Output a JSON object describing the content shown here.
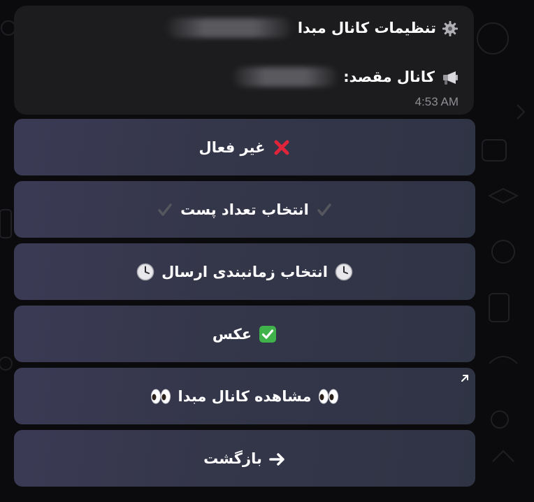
{
  "message": {
    "line1_text": "تنظیمات کانال مبدا",
    "line1_icon": "gear-icon",
    "line2_text": "کانال مقصد:",
    "line2_icon": "megaphone-icon",
    "time": "4:53 AM"
  },
  "keyboard": {
    "buttons": [
      {
        "label": "غیر فعال",
        "icon": "red-cross-icon"
      },
      {
        "label": "انتخاب تعداد پست",
        "icon": "check-mark-icon"
      },
      {
        "label": "انتخاب زمانبندی ارسال",
        "icon": "clock-icon"
      },
      {
        "label": "عکس",
        "icon": "green-check-box-icon"
      },
      {
        "label": "مشاهده کانال مبدا",
        "icon": "eyes-icon",
        "corner_icon": "external-link-arrow-icon"
      },
      {
        "label": "بازگشت",
        "icon": "right-arrow-icon"
      }
    ]
  },
  "colors": {
    "background": "#0b0b0d",
    "bubble": "#1c1c1e",
    "button": "#363850",
    "time_text": "#8e8e93"
  }
}
